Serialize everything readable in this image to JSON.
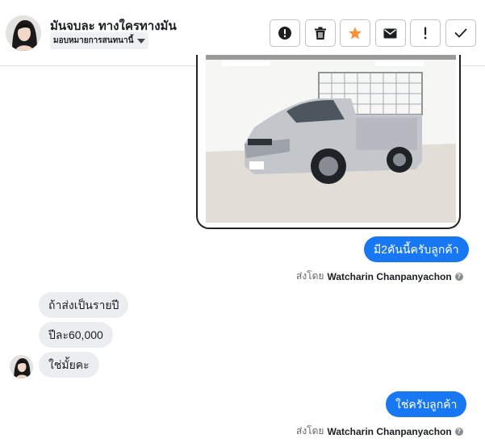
{
  "header": {
    "contact_name": "มันจบละ ทางใครทางมัน",
    "assign_label": "มอบหมายการสนทนานี้",
    "actions": [
      {
        "name": "mark-spam-button",
        "icon": "exclamation-circle-icon"
      },
      {
        "name": "delete-button",
        "icon": "trash-icon"
      },
      {
        "name": "star-button",
        "icon": "star-icon",
        "color": "#f7923a"
      },
      {
        "name": "mark-unread-button",
        "icon": "envelope-icon"
      },
      {
        "name": "follow-up-button",
        "icon": "exclamation-icon"
      },
      {
        "name": "mark-done-button",
        "icon": "check-icon"
      }
    ]
  },
  "messages": {
    "attachment": {
      "type": "image",
      "subject": "silver pickup truck with metal cage"
    },
    "out_1": {
      "text": "มี2คันนี้ครับลูกค้า",
      "sent_prefix": "ส่งโดย",
      "sender": "Watcharin Chanpanyachon"
    },
    "in_1": "ถ้าส่งเป็นรายปี",
    "in_2": "ปีละ60,000",
    "in_3": "ใช่มั้ยคะ",
    "out_2": {
      "text": "ใช่ครับลูกค้า",
      "sent_prefix": "ส่งโดย",
      "sender": "Watcharin Chanpanyachon"
    }
  },
  "colors": {
    "accent": "#1877f2",
    "incoming_bubble": "#ebedf0",
    "star": "#f7923a"
  }
}
